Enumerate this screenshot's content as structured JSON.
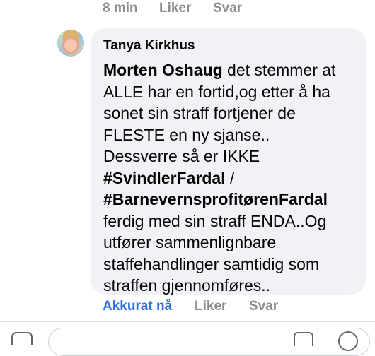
{
  "previous_comment": {
    "time": "8 min",
    "like_label": "Liker",
    "reply_label": "Svar"
  },
  "comment": {
    "author": "Tanya Kirkhus",
    "segments": [
      {
        "text": "Morten Oshaug",
        "bold": true
      },
      {
        "text": " det stemmer at ALLE har en fortid,og etter å ha sonet sin straff fortjener de FLESTE en ny sjanse..\nDessverre så er IKKE ",
        "bold": false
      },
      {
        "text": "#SvindlerFardal",
        "bold": true
      },
      {
        "text": " / ",
        "bold": false
      },
      {
        "text": "#BarnevernsprofitørenFardal",
        "bold": true
      },
      {
        "text": " ferdig med sin straff ENDA..Og utfører sammenlignbare staffehandlinger samtidig som straffen gjennomføres..",
        "bold": false
      }
    ],
    "time": "Akkurat nå",
    "like_label": "Liker",
    "reply_label": "Svar",
    "time_color": "#2d6fdb"
  },
  "icons": {
    "camera": "camera-icon",
    "sticker": "sticker-icon",
    "emoji": "emoji-icon"
  }
}
